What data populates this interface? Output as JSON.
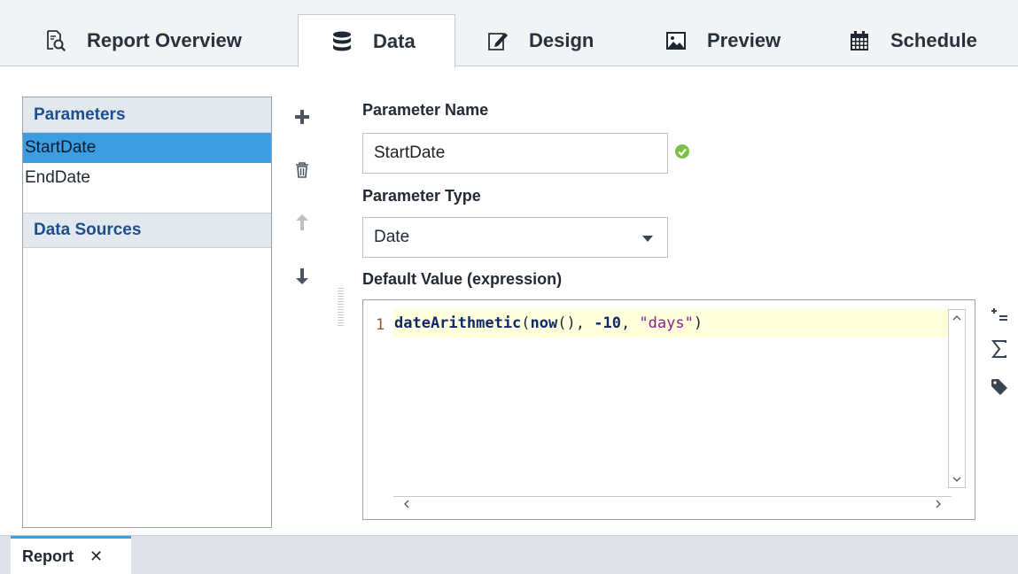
{
  "tabs": [
    {
      "label": "Report Overview",
      "icon": "search-document-icon"
    },
    {
      "label": "Data",
      "icon": "database-icon",
      "active": true
    },
    {
      "label": "Design",
      "icon": "design-pencil-icon"
    },
    {
      "label": "Preview",
      "icon": "image-icon"
    },
    {
      "label": "Schedule",
      "icon": "calendar-icon"
    }
  ],
  "left_panel": {
    "parameters_header": "Parameters",
    "parameters": [
      "StartDate",
      "EndDate"
    ],
    "selected_parameter": "StartDate",
    "data_sources_header": "Data Sources"
  },
  "toolbar": {
    "add_icon": "plus-icon",
    "delete_icon": "trash-icon",
    "move_up_icon": "arrow-up-icon",
    "move_down_icon": "arrow-down-icon"
  },
  "form": {
    "name_label": "Parameter Name",
    "name_value": "StartDate",
    "type_label": "Parameter Type",
    "type_value": "Date",
    "default_label": "Default Value (expression)"
  },
  "editor": {
    "line_number": "1",
    "code": {
      "fn1": "dateArithmetic",
      "p1": "(",
      "fn2": "now",
      "p2": "(), ",
      "num": "-10",
      "p3": ", ",
      "str": "\"days\"",
      "p4": ")"
    }
  },
  "editor_tools": {
    "insert_property_icon": "insert-property-icon",
    "functions_icon": "sigma-icon",
    "tag_icon": "tag-icon"
  },
  "bottom_tab": {
    "label": "Report",
    "close": "✕"
  },
  "colors": {
    "selection": "#3c9ee0",
    "section_header_text": "#1c4f8f",
    "valid_green": "#7ac143",
    "current_line": "#ffffdc"
  }
}
